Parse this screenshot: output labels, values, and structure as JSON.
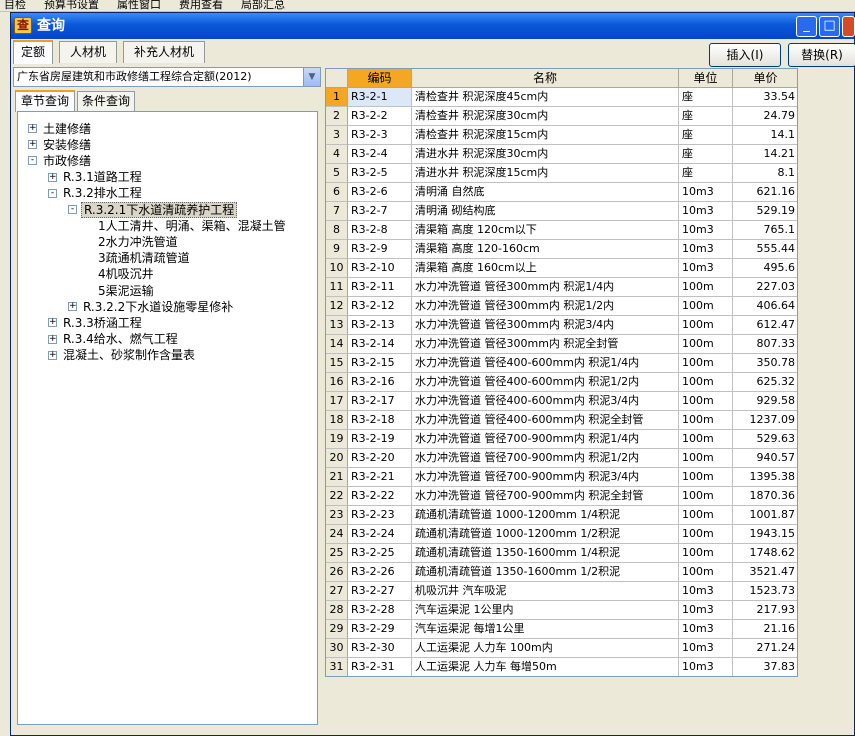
{
  "bg_toolbar": {
    "items": [
      "目检",
      "预算书设置",
      "属性窗口",
      "费用查看",
      "局部汇总"
    ]
  },
  "title": "查询",
  "app_icon_glyph": "查",
  "top_tabs": [
    {
      "label": "定额",
      "active": true
    },
    {
      "label": "人材机",
      "active": false
    },
    {
      "label": "补充人材机",
      "active": false
    }
  ],
  "buttons": {
    "insert": "插入(I)",
    "replace": "替换(R)"
  },
  "quota_select": {
    "value": "广东省房屋建筑和市政修缮工程综合定额(2012)"
  },
  "sub_tabs": [
    {
      "label": "章节查询",
      "active": true
    },
    {
      "label": "条件查询",
      "active": false
    }
  ],
  "tree": [
    {
      "label": "土建修缮",
      "level": 0,
      "expander": "+"
    },
    {
      "label": "安装修缮",
      "level": 0,
      "expander": "+"
    },
    {
      "label": "市政修缮",
      "level": 0,
      "expander": "-"
    },
    {
      "label": "R.3.1道路工程",
      "level": 1,
      "expander": "+"
    },
    {
      "label": "R.3.2排水工程",
      "level": 1,
      "expander": "-"
    },
    {
      "label": "R.3.2.1下水道清疏养护工程",
      "level": 2,
      "expander": "-",
      "selected": true
    },
    {
      "label": "1人工清井、明涌、渠箱、混凝土管",
      "level": 3,
      "expander": ""
    },
    {
      "label": "2水力冲洗管道",
      "level": 3,
      "expander": ""
    },
    {
      "label": "3疏通机清疏管道",
      "level": 3,
      "expander": ""
    },
    {
      "label": "4机吸沉井",
      "level": 3,
      "expander": ""
    },
    {
      "label": "5渠泥运输",
      "level": 3,
      "expander": ""
    },
    {
      "label": "R.3.2.2下水道设施零星修补",
      "level": 2,
      "expander": "+"
    },
    {
      "label": "R.3.3桥涵工程",
      "level": 1,
      "expander": "+"
    },
    {
      "label": "R.3.4给水、燃气工程",
      "level": 1,
      "expander": "+"
    },
    {
      "label": "混凝土、砂浆制作含量表",
      "level": 1,
      "expander": "+"
    }
  ],
  "grid": {
    "headers": {
      "code": "编码",
      "name": "名称",
      "unit": "单位",
      "price": "单价"
    },
    "rows": [
      {
        "n": "1",
        "code": "R3-2-1",
        "name": "清检查井 积泥深度45cm内",
        "unit": "座",
        "price": "33.54"
      },
      {
        "n": "2",
        "code": "R3-2-2",
        "name": "清检查井 积泥深度30cm内",
        "unit": "座",
        "price": "24.79"
      },
      {
        "n": "3",
        "code": "R3-2-3",
        "name": "清检查井 积泥深度15cm内",
        "unit": "座",
        "price": "14.1"
      },
      {
        "n": "4",
        "code": "R3-2-4",
        "name": "清进水井 积泥深度30cm内",
        "unit": "座",
        "price": "14.21"
      },
      {
        "n": "5",
        "code": "R3-2-5",
        "name": "清进水井 积泥深度15cm内",
        "unit": "座",
        "price": "8.1"
      },
      {
        "n": "6",
        "code": "R3-2-6",
        "name": "清明涌 自然底",
        "unit": "10m3",
        "price": "621.16"
      },
      {
        "n": "7",
        "code": "R3-2-7",
        "name": "清明涌 砌结构底",
        "unit": "10m3",
        "price": "529.19"
      },
      {
        "n": "8",
        "code": "R3-2-8",
        "name": "清渠箱 高度 120cm以下",
        "unit": "10m3",
        "price": "765.1"
      },
      {
        "n": "9",
        "code": "R3-2-9",
        "name": "清渠箱 高度 120-160cm",
        "unit": "10m3",
        "price": "555.44"
      },
      {
        "n": "10",
        "code": "R3-2-10",
        "name": "清渠箱 高度 160cm以上",
        "unit": "10m3",
        "price": "495.6"
      },
      {
        "n": "11",
        "code": "R3-2-11",
        "name": "水力冲洗管道 管径300mm内 积泥1/4内",
        "unit": "100m",
        "price": "227.03"
      },
      {
        "n": "12",
        "code": "R3-2-12",
        "name": "水力冲洗管道 管径300mm内 积泥1/2内",
        "unit": "100m",
        "price": "406.64"
      },
      {
        "n": "13",
        "code": "R3-2-13",
        "name": "水力冲洗管道 管径300mm内 积泥3/4内",
        "unit": "100m",
        "price": "612.47"
      },
      {
        "n": "14",
        "code": "R3-2-14",
        "name": "水力冲洗管道 管径300mm内 积泥全封管",
        "unit": "100m",
        "price": "807.33"
      },
      {
        "n": "15",
        "code": "R3-2-15",
        "name": "水力冲洗管道 管径400-600mm内 积泥1/4内",
        "unit": "100m",
        "price": "350.78"
      },
      {
        "n": "16",
        "code": "R3-2-16",
        "name": "水力冲洗管道 管径400-600mm内 积泥1/2内",
        "unit": "100m",
        "price": "625.32"
      },
      {
        "n": "17",
        "code": "R3-2-17",
        "name": "水力冲洗管道 管径400-600mm内 积泥3/4内",
        "unit": "100m",
        "price": "929.58"
      },
      {
        "n": "18",
        "code": "R3-2-18",
        "name": "水力冲洗管道 管径400-600mm内 积泥全封管",
        "unit": "100m",
        "price": "1237.09"
      },
      {
        "n": "19",
        "code": "R3-2-19",
        "name": "水力冲洗管道 管径700-900mm内 积泥1/4内",
        "unit": "100m",
        "price": "529.63"
      },
      {
        "n": "20",
        "code": "R3-2-20",
        "name": "水力冲洗管道 管径700-900mm内 积泥1/2内",
        "unit": "100m",
        "price": "940.57"
      },
      {
        "n": "21",
        "code": "R3-2-21",
        "name": "水力冲洗管道 管径700-900mm内 积泥3/4内",
        "unit": "100m",
        "price": "1395.38"
      },
      {
        "n": "22",
        "code": "R3-2-22",
        "name": "水力冲洗管道 管径700-900mm内 积泥全封管",
        "unit": "100m",
        "price": "1870.36"
      },
      {
        "n": "23",
        "code": "R3-2-23",
        "name": "疏通机清疏管道 1000-1200mm 1/4积泥",
        "unit": "100m",
        "price": "1001.87"
      },
      {
        "n": "24",
        "code": "R3-2-24",
        "name": "疏通机清疏管道 1000-1200mm 1/2积泥",
        "unit": "100m",
        "price": "1943.15"
      },
      {
        "n": "25",
        "code": "R3-2-25",
        "name": "疏通机清疏管道 1350-1600mm 1/4积泥",
        "unit": "100m",
        "price": "1748.62"
      },
      {
        "n": "26",
        "code": "R3-2-26",
        "name": "疏通机清疏管道 1350-1600mm 1/2积泥",
        "unit": "100m",
        "price": "3521.47"
      },
      {
        "n": "27",
        "code": "R3-2-27",
        "name": "机吸沉井 汽车吸泥",
        "unit": "10m3",
        "price": "1523.73"
      },
      {
        "n": "28",
        "code": "R3-2-28",
        "name": "汽车运渠泥 1公里内",
        "unit": "10m3",
        "price": "217.93"
      },
      {
        "n": "29",
        "code": "R3-2-29",
        "name": "汽车运渠泥 每增1公里",
        "unit": "10m3",
        "price": "21.16"
      },
      {
        "n": "30",
        "code": "R3-2-30",
        "name": "人工运渠泥 人力车 100m内",
        "unit": "10m3",
        "price": "271.24"
      },
      {
        "n": "31",
        "code": "R3-2-31",
        "name": "人工运渠泥 人力车 每增50m",
        "unit": "10m3",
        "price": "37.83"
      }
    ]
  },
  "icons": {
    "minimize": "minimize-icon",
    "maximize": "maximize-icon",
    "close": "close-icon",
    "dropdown": "chevron-down-icon"
  },
  "colors": {
    "title_bar": "#0a58d8",
    "selected_header": "#f5a623",
    "selected_cell": "#dce8f8"
  }
}
